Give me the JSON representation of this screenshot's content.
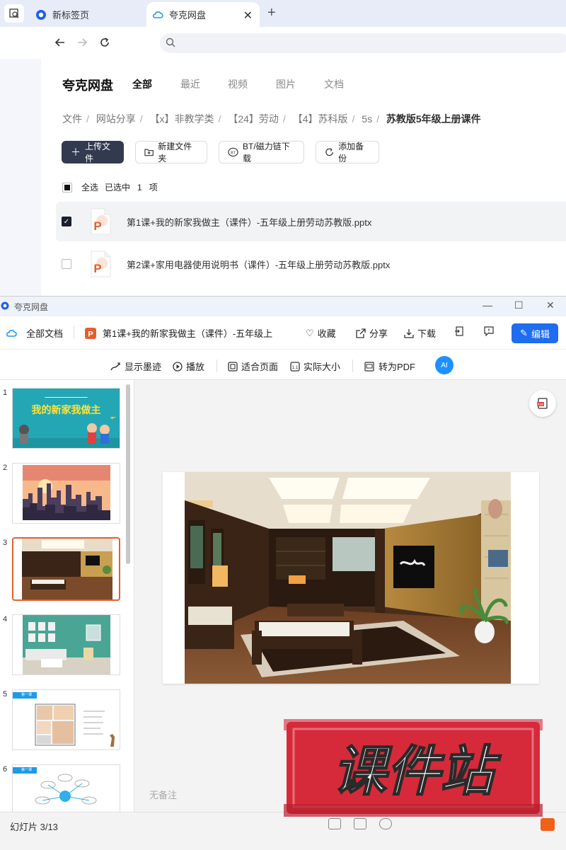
{
  "browser": {
    "tabs": [
      {
        "label": "新标签页",
        "active": false
      },
      {
        "label": "夸克网盘",
        "active": true
      }
    ],
    "address": ""
  },
  "page": {
    "brand": "夸克网盘",
    "tabs": [
      "全部",
      "最近",
      "视频",
      "图片",
      "文档"
    ],
    "breadcrumbs": [
      "文件",
      "网站分享",
      "【x】非教学类",
      "【24】劳动",
      "【4】苏科版",
      "5s",
      "苏教版5年级上册课件"
    ],
    "actions": [
      "上传文件",
      "新建文件夹",
      "BT/磁力链下载",
      "添加备份"
    ],
    "select_all": "全选",
    "selected_text": "已选中",
    "selected_count": "1",
    "selected_unit": "项",
    "files": [
      {
        "name": "第1课+我的新家我做主（课件）-五年级上册劳动苏教版.pptx",
        "checked": true
      },
      {
        "name": "第2课+家用电器使用说明书（课件）-五年级上册劳动苏教版.pptx",
        "checked": false
      }
    ]
  },
  "viewer": {
    "window_title": "夸克网盘",
    "all_docs": "全部文档",
    "doc_title": "第1课+我的新家我做主（课件）-五年级上",
    "actions": {
      "collect": "收藏",
      "share": "分享",
      "download": "下载",
      "edit": "编辑"
    },
    "toolbar": {
      "ink": "显示墨迹",
      "play": "播放",
      "fit": "适合页面",
      "actual": "实际大小",
      "pdf": "转为PDF"
    },
    "ai_label": "AI",
    "thumbnails": [
      {
        "num": "1",
        "caption": "我的新家我做主"
      },
      {
        "num": "2",
        "caption": ""
      },
      {
        "num": "3",
        "caption": ""
      },
      {
        "num": "4",
        "caption": ""
      },
      {
        "num": "5",
        "caption": "第一课"
      },
      {
        "num": "6",
        "caption": "第一课"
      }
    ],
    "current_slide": 3,
    "notes": "无备注",
    "status": "幻灯片 3/13"
  },
  "watermark": "课件站",
  "colors": {
    "accent": "#1e6cf0",
    "ppt": "#e06030",
    "watermark": "#d8283a"
  }
}
